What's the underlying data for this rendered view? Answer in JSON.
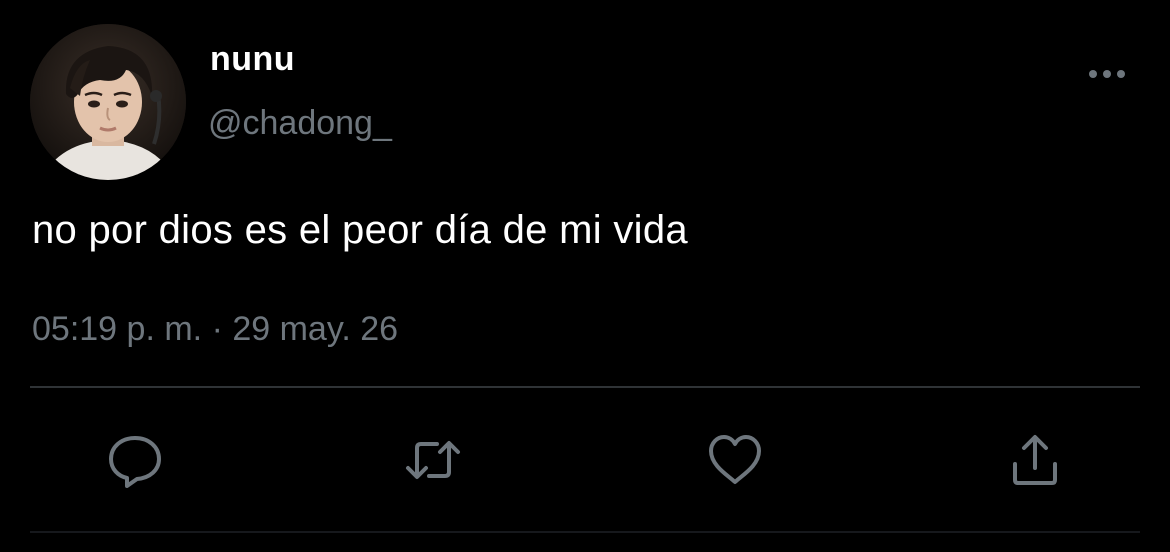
{
  "tweet": {
    "display_name": "nunu",
    "handle": "@chadong_",
    "text": "no por dios es el peor día de mi vida",
    "time": "05:19 p. m.",
    "separator": "·",
    "date": "29 may. 26"
  },
  "actions": {
    "reply_icon": "comment-bubble-icon",
    "retweet_icon": "retweet-arrows-icon",
    "like_icon": "heart-icon",
    "share_icon": "share-upload-icon",
    "more_icon": "ellipsis-icon"
  },
  "colors": {
    "background": "#000000",
    "primary_text": "#ffffff",
    "secondary_text": "#6e767d",
    "icon": "#6e767d",
    "divider": "#2f3336"
  }
}
